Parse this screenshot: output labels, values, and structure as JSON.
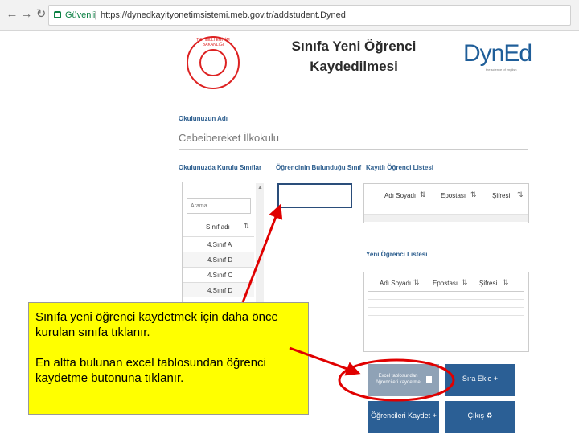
{
  "browser": {
    "secure_label": "Güvenli",
    "url": "https://dynedkayityonetimsistemi.meb.gov.tr/addstudent.Dyned"
  },
  "emblem": {
    "text": "T.C. MİLLÎ EĞİTİM BAKANLIĞI"
  },
  "header": {
    "title_line1": "Sınıfa Yeni Öğrenci",
    "title_line2": "Kaydedilmesi"
  },
  "brand": {
    "name": "DynEd",
    "tagline": "the science of english"
  },
  "form": {
    "school_label": "Okulunuzun Adı",
    "school_value": "Cebeibereket İlkokulu"
  },
  "classes_panel": {
    "title": "Okulunuzda Kurulu Sınıflar",
    "search_placeholder": "Arama...",
    "column": "Sınıf adı",
    "rows": [
      "4.Sınıf A",
      "4.Sınıf D",
      "4.Sınıf C",
      "4.Sınıf D"
    ]
  },
  "student_class_panel": {
    "title": "Öğrencinin Bulunduğu Sınıf"
  },
  "registered_list": {
    "title": "Kayıtlı Öğrenci Listesi",
    "columns": [
      "Adı Soyadı",
      "Epostası",
      "Şifresi"
    ]
  },
  "new_list": {
    "title": "Yeni Öğrenci Listesi",
    "columns": [
      "Adı Soyadı",
      "Epostası",
      "Şifresi"
    ]
  },
  "buttons": {
    "excel": "Excel tablosundan öğrencileri kaydetme",
    "add_row": "Sıra Ekle +",
    "save_students": "Öğrencileri Kaydet +",
    "exit": "Çıkış ♻"
  },
  "annotation": {
    "line1": "Sınıfa yeni öğrenci kaydetmek için daha önce kurulan sınıfa tıklanır.",
    "line2": "En altta bulunan excel tablosundan öğrenci kaydetme butonuna tıklanır."
  },
  "colors": {
    "highlight": "#ffff00",
    "arrow": "#e00000",
    "button_blue": "#2b5f95",
    "button_grey": "#8fa2b6"
  }
}
